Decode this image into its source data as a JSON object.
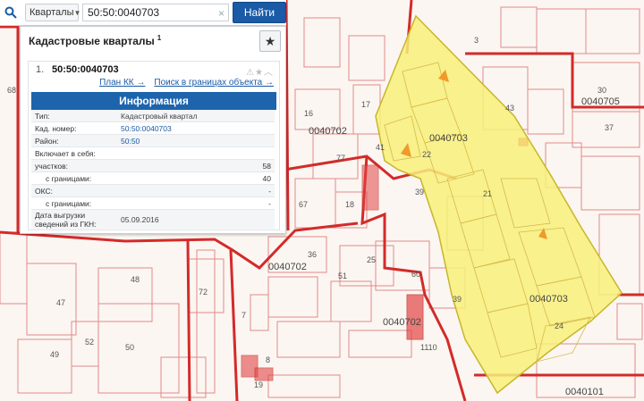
{
  "search": {
    "type_label": "Кварталы",
    "query": "50:50:0040703",
    "clear_glyph": "×",
    "find_label": "Найти"
  },
  "panel": {
    "title": "Кадастровые кварталы",
    "count": "1",
    "result": {
      "index": "1.",
      "number": "50:50:0040703",
      "link_plan": "План КК →",
      "link_search": "Поиск в границах объекта →",
      "info_title": "Информация",
      "rows": {
        "type_k": "Тип:",
        "type_v": "Кадастровый квартал",
        "cadnum_k": "Кад. номер:",
        "cadnum_v": "50:50:0040703",
        "district_k": "Район:",
        "district_v": "50:50",
        "includes_k": "Включает в себя:",
        "parcels_k": "участков:",
        "parcels_v": "58",
        "parcels_b_k": "с границами:",
        "parcels_b_v": "40",
        "oks_k": "ОКС:",
        "oks_v": "-",
        "oks_b_k": "с границами:",
        "oks_b_v": "-",
        "date_k1": "Дата выгрузки",
        "date_k2": "сведений из ГКН:",
        "date_v": "05.09.2016"
      }
    }
  },
  "map": {
    "labels": {
      "q_703_a": "0040703",
      "q_703_b": "0040703",
      "q_702_a": "0040702",
      "q_702_b": "0040702",
      "q_702_c": "0040702",
      "q_705": "0040705",
      "q_101": "0040101",
      "p30": "30",
      "p37": "37",
      "p43": "43",
      "p17": "17",
      "p16": "16",
      "p77": "77",
      "p67": "67",
      "p18": "18",
      "p41": "41",
      "p39a": "39",
      "p39b": "39",
      "p60": "60",
      "p25": "25",
      "p51": "51",
      "p48": "48",
      "p47": "47",
      "p72": "72",
      "p50": "50",
      "p52": "52",
      "p49": "49",
      "p8": "8",
      "p68": "68",
      "p36": "36",
      "p19": "19",
      "p7": "7",
      "p1110": "1110",
      "p3": "3",
      "p21": "21",
      "p22": "22",
      "p24": "24"
    },
    "colors": {
      "boundary": "#d42a2a",
      "highlight_fill": "#f7f07a",
      "highlight_stroke": "#c9b52a"
    }
  }
}
